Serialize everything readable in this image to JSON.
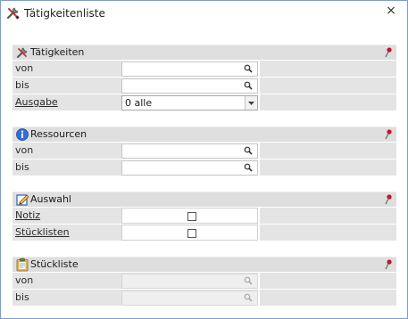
{
  "window": {
    "title": "Tätigkeitenliste",
    "close_glyph": "×"
  },
  "sections": {
    "taetigkeiten": {
      "title": "Tätigkeiten",
      "icon": "tools-icon",
      "rows": {
        "von": "von",
        "bis": "bis",
        "ausgabe": "Ausgabe"
      },
      "ausgabe_value": "0 alle"
    },
    "ressourcen": {
      "title": "Ressourcen",
      "icon": "info-icon",
      "rows": {
        "von": "von",
        "bis": "bis"
      }
    },
    "auswahl": {
      "title": "Auswahl",
      "icon": "edit-icon",
      "rows": {
        "notiz": "Notiz",
        "stuecklisten": "Stücklisten"
      },
      "notiz_checked": false,
      "stuecklisten_checked": false
    },
    "stueckliste": {
      "title": "Stückliste",
      "icon": "clipboard-icon",
      "rows": {
        "von": "von",
        "bis": "bis"
      },
      "disabled": true
    }
  },
  "colors": {
    "header_bg": "#dedede",
    "label_bg": "#e4e4e4",
    "window_border": "#7a9ec8",
    "pin_red": "#c8102e"
  }
}
